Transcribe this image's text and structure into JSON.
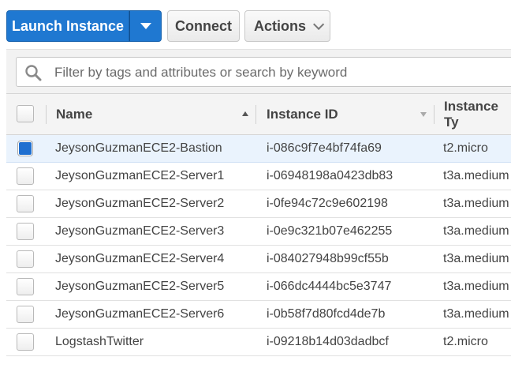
{
  "toolbar": {
    "launch_label": "Launch Instance",
    "connect_label": "Connect",
    "actions_label": "Actions"
  },
  "search": {
    "placeholder": "Filter by tags and attributes or search by keyword"
  },
  "table": {
    "columns": [
      {
        "label": "Name"
      },
      {
        "label": "Instance ID"
      },
      {
        "label": "Instance Ty"
      }
    ],
    "rows": [
      {
        "name": "JeysonGuzmanECE2-Bastion",
        "id": "i-086c9f7e4bf74fa69",
        "type": "t2.micro",
        "selected": true
      },
      {
        "name": "JeysonGuzmanECE2-Server1",
        "id": "i-06948198a0423db83",
        "type": "t3a.medium",
        "selected": false
      },
      {
        "name": "JeysonGuzmanECE2-Server2",
        "id": "i-0fe94c72c9e602198",
        "type": "t3a.medium",
        "selected": false
      },
      {
        "name": "JeysonGuzmanECE2-Server3",
        "id": "i-0e9c321b07e462255",
        "type": "t3a.medium",
        "selected": false
      },
      {
        "name": "JeysonGuzmanECE2-Server4",
        "id": "i-084027948b99cf55b",
        "type": "t3a.medium",
        "selected": false
      },
      {
        "name": "JeysonGuzmanECE2-Server5",
        "id": "i-066dc4444bc5e3747",
        "type": "t3a.medium",
        "selected": false
      },
      {
        "name": "JeysonGuzmanECE2-Server6",
        "id": "i-0b58f7d80fcd4de7b",
        "type": "t3a.medium",
        "selected": false
      },
      {
        "name": "LogstashTwitter",
        "id": "i-09218b14d03dadbcf",
        "type": "t2.micro",
        "selected": false
      }
    ]
  },
  "colors": {
    "primary_button": "#1f78d1",
    "selected_row": "#eaf3fd",
    "checkbox_checked": "#1f6fd0"
  },
  "icons": {
    "search": "search-icon",
    "launch_menu": "caret-down-icon",
    "actions_menu": "chevron-down-icon"
  }
}
